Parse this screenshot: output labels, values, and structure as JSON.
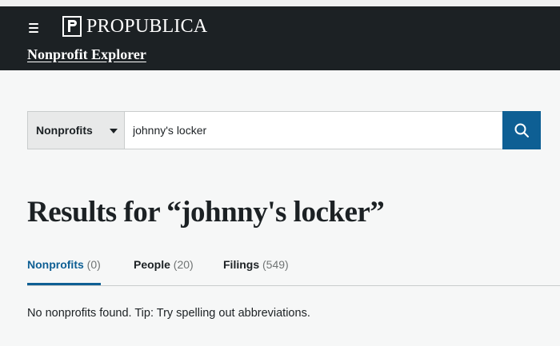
{
  "header": {
    "brand": "ProPublica",
    "app_title": "Nonprofit Explorer",
    "menu_icon": "hamburger-menu-icon",
    "logo_icon": "propublica-logo-mark"
  },
  "search": {
    "type_selected": "Nonprofits",
    "query": "johnny's locker",
    "button_icon": "search-icon",
    "accent_color": "#0e5f94"
  },
  "results": {
    "title": "Results for “johnny's locker”"
  },
  "tabs": [
    {
      "label": "Nonprofits",
      "count": "(0)",
      "active": true
    },
    {
      "label": "People",
      "count": "(20)",
      "active": false
    },
    {
      "label": "Filings",
      "count": "(549)",
      "active": false
    }
  ],
  "message": "No nonprofits found. Tip: Try spelling out abbreviations."
}
